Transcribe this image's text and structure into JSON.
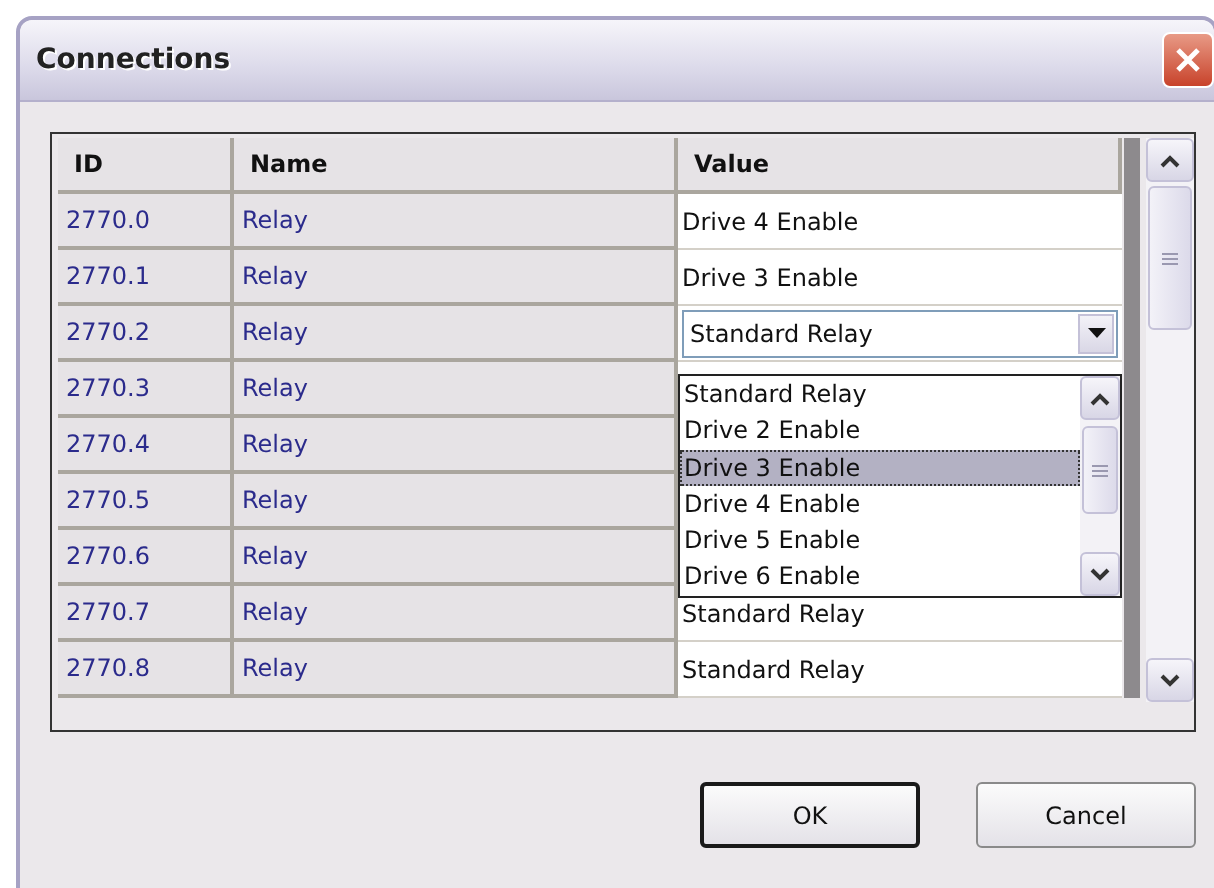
{
  "window": {
    "title": "Connections"
  },
  "table": {
    "columns": [
      "ID",
      "Name",
      "Value"
    ],
    "rows": [
      {
        "id": "2770.0",
        "name": "Relay",
        "kind": "text",
        "value": "Drive 4 Enable"
      },
      {
        "id": "2770.1",
        "name": "Relay",
        "kind": "text",
        "value": "Drive 3 Enable"
      },
      {
        "id": "2770.2",
        "name": "Relay",
        "kind": "combo",
        "value": "Standard Relay"
      },
      {
        "id": "2770.3",
        "name": "Relay",
        "kind": "covered"
      },
      {
        "id": "2770.4",
        "name": "Relay",
        "kind": "covered"
      },
      {
        "id": "2770.5",
        "name": "Relay",
        "kind": "covered"
      },
      {
        "id": "2770.6",
        "name": "Relay",
        "kind": "covered"
      },
      {
        "id": "2770.7",
        "name": "Relay",
        "kind": "text",
        "value": "Standard Relay"
      },
      {
        "id": "2770.8",
        "name": "Relay",
        "kind": "text",
        "value": "Standard Relay"
      }
    ]
  },
  "dropdown": {
    "items": [
      {
        "label": "Standard Relay",
        "selected": false
      },
      {
        "label": "Drive 2 Enable",
        "selected": false
      },
      {
        "label": "Drive 3 Enable",
        "selected": true
      },
      {
        "label": "Drive 4 Enable",
        "selected": false
      },
      {
        "label": "Drive 5 Enable",
        "selected": false
      },
      {
        "label": "Drive 6 Enable",
        "selected": false
      }
    ]
  },
  "buttons": [
    {
      "label": "OK",
      "default": true
    },
    {
      "label": "Cancel",
      "default": false
    }
  ]
}
